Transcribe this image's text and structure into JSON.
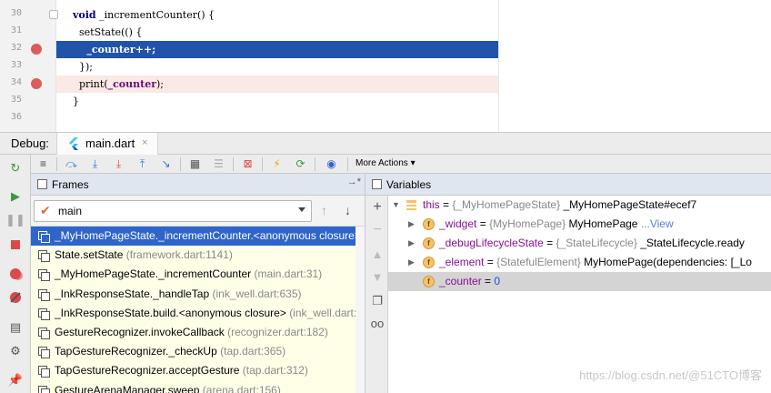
{
  "editor": {
    "lines": [
      {
        "num": "30",
        "breakpoint": false,
        "fold": true,
        "state": "normal",
        "text": "void _incrementCounter() {"
      },
      {
        "num": "31",
        "breakpoint": false,
        "fold": false,
        "state": "normal",
        "text": "  setState(() {"
      },
      {
        "num": "32",
        "breakpoint": true,
        "fold": false,
        "state": "exec",
        "text": "    _counter++;"
      },
      {
        "num": "33",
        "breakpoint": false,
        "fold": false,
        "state": "normal",
        "text": "  });"
      },
      {
        "num": "34",
        "breakpoint": true,
        "fold": false,
        "state": "bpline",
        "text": "  print(_counter);"
      },
      {
        "num": "35",
        "breakpoint": false,
        "fold": false,
        "state": "normal",
        "text": "}"
      },
      {
        "num": "36",
        "breakpoint": false,
        "fold": false,
        "state": "normal",
        "text": ""
      }
    ]
  },
  "debug_bar": {
    "label": "Debug:",
    "tab_label": "main.dart",
    "close_glyph": "×"
  },
  "toolbar": {
    "more_actions": "More Actions"
  },
  "frames": {
    "title": "Frames",
    "pin_glyph": "→*",
    "thread": "main",
    "rows": [
      {
        "method": "_MyHomePageState._incrementCounter.<anonymous closure>",
        "location": "",
        "selected": true
      },
      {
        "method": "State.setState",
        "location": "(framework.dart:1141)",
        "selected": false
      },
      {
        "method": "_MyHomePageState._incrementCounter",
        "location": "(main.dart:31)",
        "selected": false
      },
      {
        "method": "_InkResponseState._handleTap",
        "location": "(ink_well.dart:635)",
        "selected": false
      },
      {
        "method": "_InkResponseState.build.<anonymous closure>",
        "location": "(ink_well.dart:…)",
        "selected": false
      },
      {
        "method": "GestureRecognizer.invokeCallback",
        "location": "(recognizer.dart:182)",
        "selected": false
      },
      {
        "method": "TapGestureRecognizer._checkUp",
        "location": "(tap.dart:365)",
        "selected": false
      },
      {
        "method": "TapGestureRecognizer.acceptGesture",
        "location": "(tap.dart:312)",
        "selected": false
      },
      {
        "method": "GestureArenaManager.sweep",
        "location": "(arena.dart:156)",
        "selected": false
      }
    ]
  },
  "variables": {
    "title": "Variables",
    "rows": [
      {
        "expanded": true,
        "icon": "this",
        "name": "this",
        "type": "{_MyHomePageState}",
        "value": "_MyHomePageState#ecef7",
        "link": "",
        "numeric": false,
        "highlighted": false
      },
      {
        "expanded": false,
        "icon": "field",
        "name": "_widget",
        "type": "{MyHomePage}",
        "value": "MyHomePage",
        "link": "...View",
        "numeric": false,
        "highlighted": false
      },
      {
        "expanded": false,
        "icon": "field",
        "name": "_debugLifecycleState",
        "type": "{_StateLifecycle}",
        "value": "_StateLifecycle.ready",
        "link": "",
        "numeric": false,
        "highlighted": false
      },
      {
        "expanded": false,
        "icon": "field",
        "name": "_element",
        "type": "{StatefulElement}",
        "value": "MyHomePage(dependencies: [_Lo",
        "link": "",
        "numeric": false,
        "highlighted": false
      },
      {
        "expanded": null,
        "icon": "field",
        "name": "_counter",
        "type": "",
        "value": "0",
        "link": "",
        "numeric": true,
        "highlighted": true
      }
    ]
  },
  "watermark": "https://blog.csdn.net/@51CTO博客"
}
